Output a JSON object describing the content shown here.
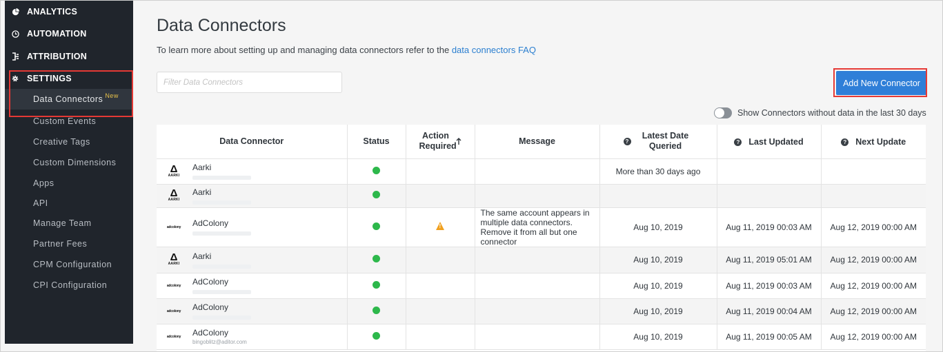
{
  "sidebar": {
    "sections": [
      {
        "label": "ANALYTICS",
        "icon": "pie-chart-icon"
      },
      {
        "label": "AUTOMATION",
        "icon": "clock-icon"
      },
      {
        "label": "ATTRIBUTION",
        "icon": "attribution-icon"
      },
      {
        "label": "SETTINGS",
        "icon": "gear-icon"
      }
    ],
    "items": [
      {
        "label": "Data Connectors",
        "badge": "New",
        "active": true
      },
      {
        "label": "Custom Events"
      },
      {
        "label": "Creative Tags"
      },
      {
        "label": "Custom Dimensions"
      },
      {
        "label": "Apps"
      },
      {
        "label": "API"
      },
      {
        "label": "Manage Team"
      },
      {
        "label": "Partner Fees"
      },
      {
        "label": "CPM Configuration"
      },
      {
        "label": "CPI Configuration"
      }
    ]
  },
  "main": {
    "title": "Data Connectors",
    "subtitle": "To learn more about setting up and managing data connectors refer to the ",
    "subtitle_link": "data connectors FAQ",
    "filter_placeholder": "Filter Data Connectors",
    "add_button": "Add New Connector",
    "toggle_label": "Show Connectors without data in the last 30 days"
  },
  "table": {
    "columns": [
      "Data Connector",
      "Status",
      "Action Required",
      "Message",
      "Latest Date Queried",
      "Last Updated",
      "Next Update"
    ],
    "rows": [
      {
        "connector": "Aarki",
        "logo": "aarki",
        "sub": "",
        "status": "ok",
        "action": "",
        "message": "",
        "latest": "More than 30 days ago",
        "last_updated": "",
        "next_update": ""
      },
      {
        "connector": "Aarki",
        "logo": "aarki",
        "sub": "",
        "status": "ok",
        "action": "",
        "message": "",
        "latest": "",
        "last_updated": "",
        "next_update": ""
      },
      {
        "connector": "AdColony",
        "logo": "adcolony",
        "sub": "",
        "status": "ok",
        "action": "warning",
        "message": "The same account appears in multiple data connectors. Remove it from all but one connector",
        "latest": "Aug 10, 2019",
        "last_updated": "Aug 11, 2019 00:03 AM",
        "next_update": "Aug 12, 2019 00:00 AM"
      },
      {
        "connector": "Aarki",
        "logo": "aarki",
        "sub": "",
        "status": "ok",
        "action": "",
        "message": "",
        "latest": "Aug 10, 2019",
        "last_updated": "Aug 11, 2019 05:01 AM",
        "next_update": "Aug 12, 2019 00:00 AM"
      },
      {
        "connector": "AdColony",
        "logo": "adcolony",
        "sub": "",
        "status": "ok",
        "action": "",
        "message": "",
        "latest": "Aug 10, 2019",
        "last_updated": "Aug 11, 2019 00:03 AM",
        "next_update": "Aug 12, 2019 00:00 AM"
      },
      {
        "connector": "AdColony",
        "logo": "adcolony",
        "sub": "",
        "status": "ok",
        "action": "",
        "message": "",
        "latest": "Aug 10, 2019",
        "last_updated": "Aug 11, 2019 00:04 AM",
        "next_update": "Aug 12, 2019 00:00 AM"
      },
      {
        "connector": "AdColony",
        "logo": "adcolony",
        "sub": "bingoblitz@aditor.com",
        "status": "ok",
        "action": "",
        "message": "",
        "latest": "Aug 10, 2019",
        "last_updated": "Aug 11, 2019 00:05 AM",
        "next_update": "Aug 12, 2019 00:00 AM"
      }
    ]
  },
  "logos": {
    "aarki_text": "AARKI",
    "adcolony_text": "adcolony"
  },
  "colors": {
    "accent": "#2f7fd8",
    "status_ok": "#2db84b",
    "warning": "#f0a01f",
    "sidebar_bg": "#20252c",
    "highlight": "#e53935"
  }
}
